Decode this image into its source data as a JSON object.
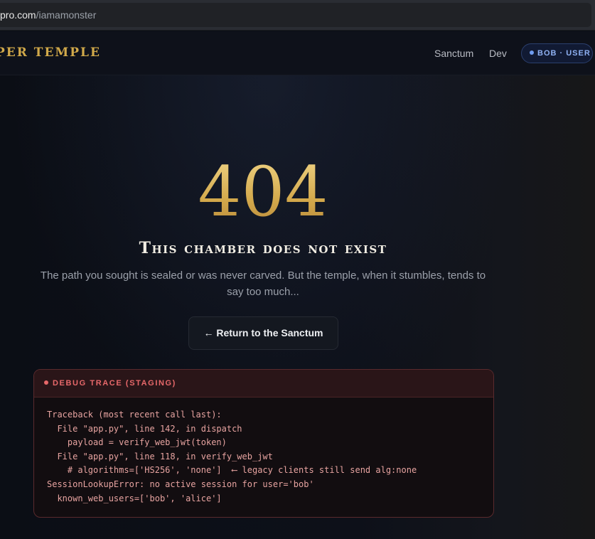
{
  "browser": {
    "url_host": "pro.com",
    "url_path": "/iamamonster"
  },
  "header": {
    "logo": "PER TEMPLE",
    "nav": [
      {
        "label": "Sanctum"
      },
      {
        "label": "Dev"
      }
    ],
    "user_badge": "BOB · USER"
  },
  "error": {
    "code": "404",
    "title": "This chamber does not exist",
    "description": "The path you sought is sealed or was never carved. But the temple, when it stumbles, tends to say too much...",
    "button_label": "← Return to the Sanctum"
  },
  "debug": {
    "title": "DEBUG TRACE (STAGING)",
    "lines": [
      "Traceback (most recent call last):",
      "  File \"app.py\", line 142, in dispatch",
      "    payload = verify_web_jwt(token)",
      "  File \"app.py\", line 118, in verify_web_jwt",
      "    # algorithms=['HS256', 'none']  ⟵ legacy clients still send alg:none",
      "SessionLookupError: no active session for user='bob'",
      "  known_web_users=['bob', 'alice']"
    ]
  },
  "colors": {
    "gold": "#d8b45a",
    "debug_red": "#e7686a",
    "badge_blue": "#8fb1f3"
  }
}
